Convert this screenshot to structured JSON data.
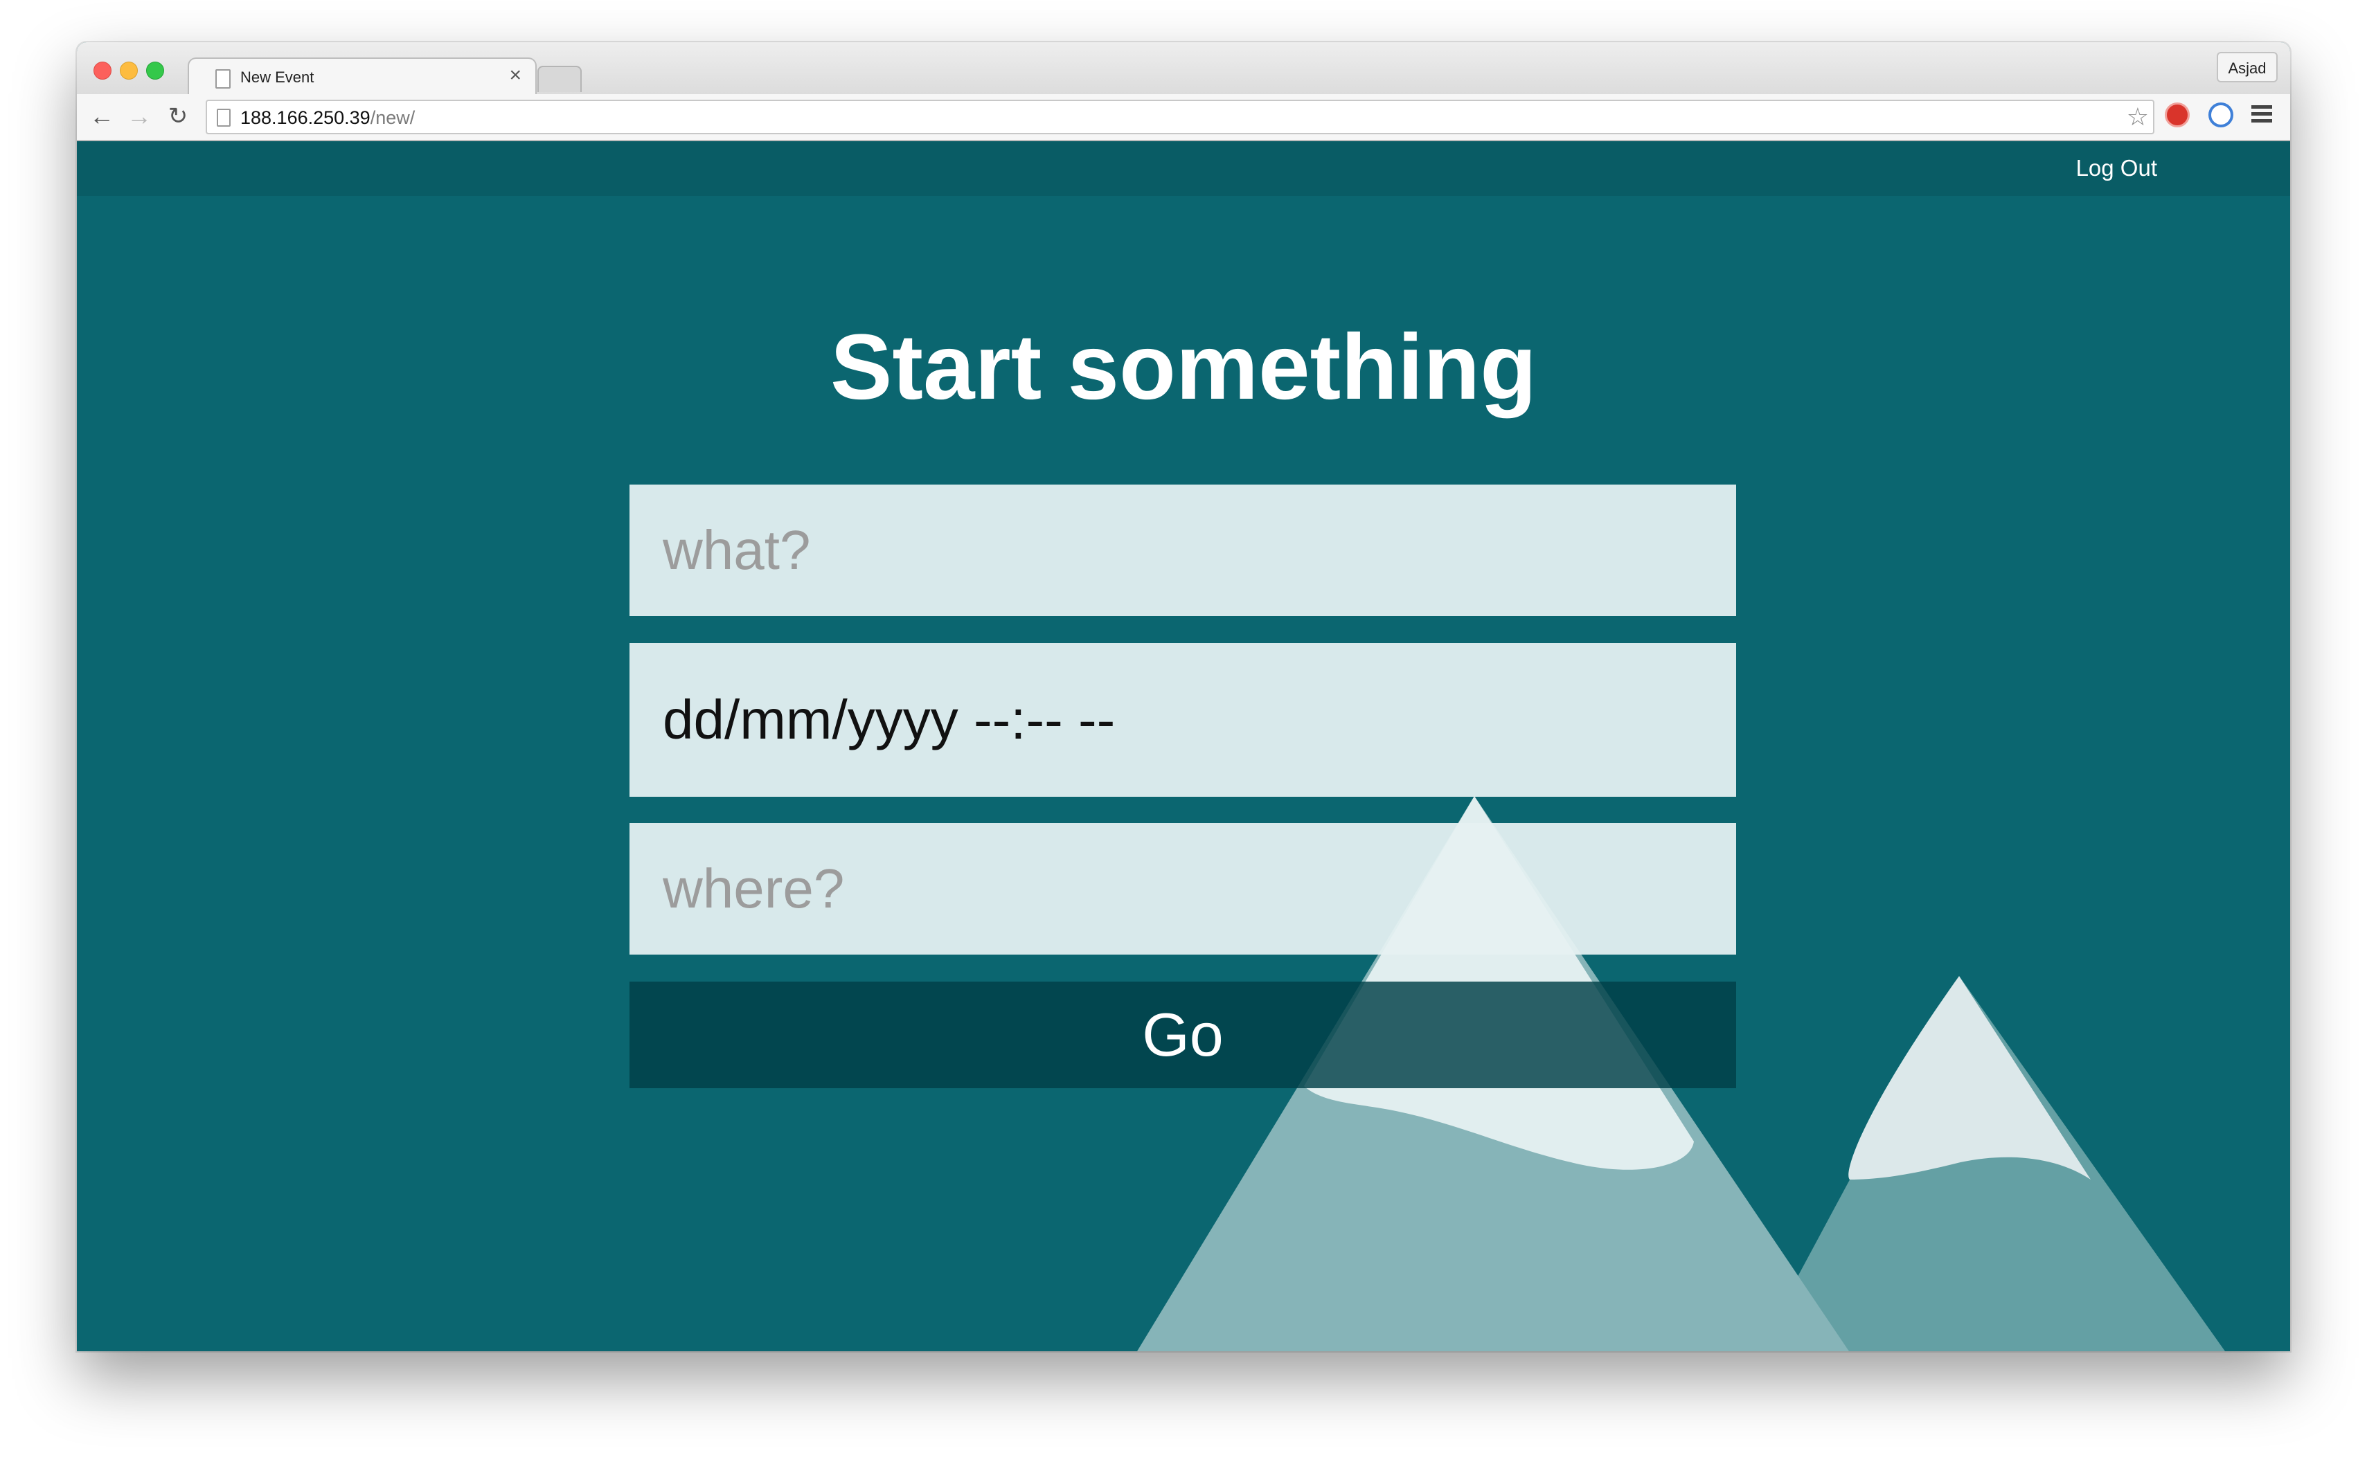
{
  "browser": {
    "tab_title": "New Event",
    "tab_close": "×",
    "profile_name": "Asjad",
    "url_host": "188.166.250.39",
    "url_path": "/new/",
    "icons": {
      "back": "left-arrow-icon",
      "forward": "right-arrow-icon",
      "reload": "reload-icon",
      "bookmark": "star-icon",
      "menu": "hamburger-menu-icon"
    }
  },
  "nav": {
    "logout_label": "Log Out"
  },
  "form": {
    "heading": "Start something",
    "what_placeholder": "what?",
    "when_value": "dd/mm/yyyy --:-- --",
    "where_placeholder": "where?",
    "go_label": "Go"
  },
  "colors": {
    "page_background": "#0b6670",
    "nav_background": "#095c65",
    "button_background": "#004048",
    "field_background": "#e5f1f2",
    "mountain_left": "#86b4b8",
    "mountain_right": "#64a0a4",
    "snow": "#ffffff"
  }
}
